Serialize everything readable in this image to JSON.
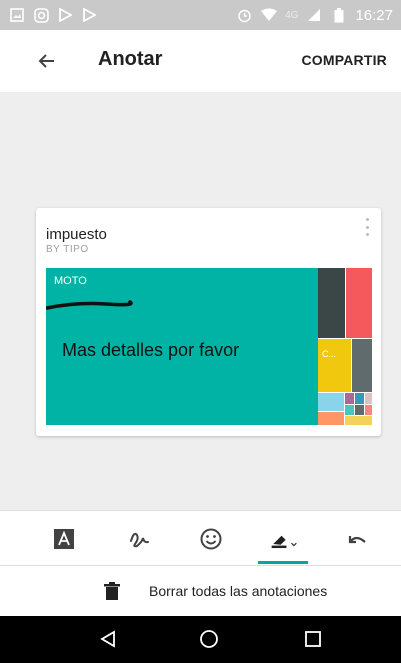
{
  "status_bar": {
    "time": "16:27",
    "network": "4G",
    "left_icons": [
      "image-icon",
      "instagram-icon",
      "play-store-icon",
      "play-store-icon"
    ],
    "right_icons": [
      "alarm-icon",
      "wifi-icon",
      "signal-icon",
      "battery-icon"
    ]
  },
  "appbar": {
    "title": "Anotar",
    "share_label": "COMPARTIR",
    "back_icon": "arrow-back-icon"
  },
  "card": {
    "title": "impuesto",
    "subtitle": "BY TIPO",
    "menu_icon": "more-vert-icon",
    "treemap": {
      "main_label": "MOTO",
      "secondary_label": "C...",
      "colors": {
        "moto": "#00b3a4",
        "dark": "#3b4747",
        "red": "#f6595b",
        "yellow": "#f2c80f",
        "gray": "#5f6b6d",
        "lightblue": "#8ad4eb",
        "orange": "#fe9666"
      }
    },
    "annotation_text": "Mas detalles por favor"
  },
  "toolbar": {
    "tools": [
      "text-tool-icon",
      "pen-tool-icon",
      "emoji-tool-icon",
      "highlighter-tool-icon",
      "undo-icon"
    ],
    "active_tool": "highlighter-tool-icon",
    "accent_color": "#00a99d"
  },
  "clear_all": {
    "label": "Borrar todas las anotaciones",
    "icon": "trash-icon"
  },
  "navbar": {
    "buttons": [
      "back-triangle-icon",
      "home-circle-icon",
      "recents-square-icon"
    ]
  }
}
